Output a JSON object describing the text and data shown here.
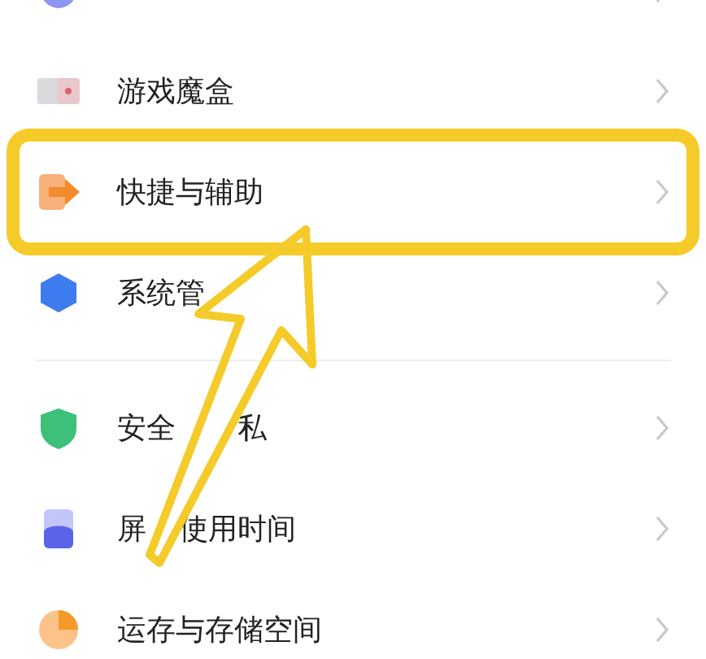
{
  "groups": [
    {
      "items": [
        {
          "selected": false
        },
        {
          "label": "游戏魔盒",
          "selected": false
        },
        {
          "label": "快捷与辅助",
          "selected": true
        },
        {
          "label": "系统管",
          "selected": false
        }
      ]
    },
    {
      "items": [
        {
          "label": "安全",
          "label_after": "私",
          "selected": false
        },
        {
          "label": "屏",
          "label_after": "使用时间",
          "selected": false
        },
        {
          "label": "运存与存储空间",
          "selected": false
        }
      ]
    }
  ]
}
